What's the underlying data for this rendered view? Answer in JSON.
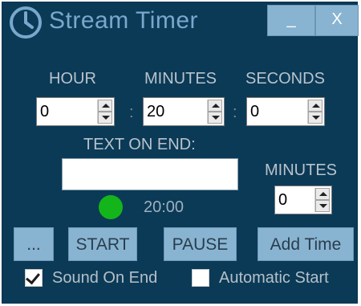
{
  "app": {
    "title": "Stream Timer"
  },
  "titlebar": {
    "minimize_label": "_",
    "close_label": "X"
  },
  "icons": {
    "app_icon": "clock-icon"
  },
  "timer": {
    "hour_label": "HOUR",
    "minutes_label": "MINUTES",
    "seconds_label": "SECONDS",
    "hour_value": "0",
    "minutes_value": "20",
    "seconds_value": "0",
    "separator": ":"
  },
  "text_on_end": {
    "label": "TEXT ON END:",
    "value": ""
  },
  "add_minutes": {
    "label": "MINUTES",
    "value": "0"
  },
  "status": {
    "indicator_color": "#14b51a",
    "time_display": "20:00"
  },
  "buttons": {
    "browse_label": "...",
    "start_label": "START",
    "pause_label": "PAUSE",
    "add_time_label": "Add Time"
  },
  "options": {
    "sound_on_end_label": "Sound On End",
    "sound_on_end_checked": true,
    "automatic_start_label": "Automatic Start",
    "automatic_start_checked": false
  },
  "colors": {
    "background": "#0b3a57",
    "button": "#88b4d2",
    "indicator": "#14b51a"
  }
}
